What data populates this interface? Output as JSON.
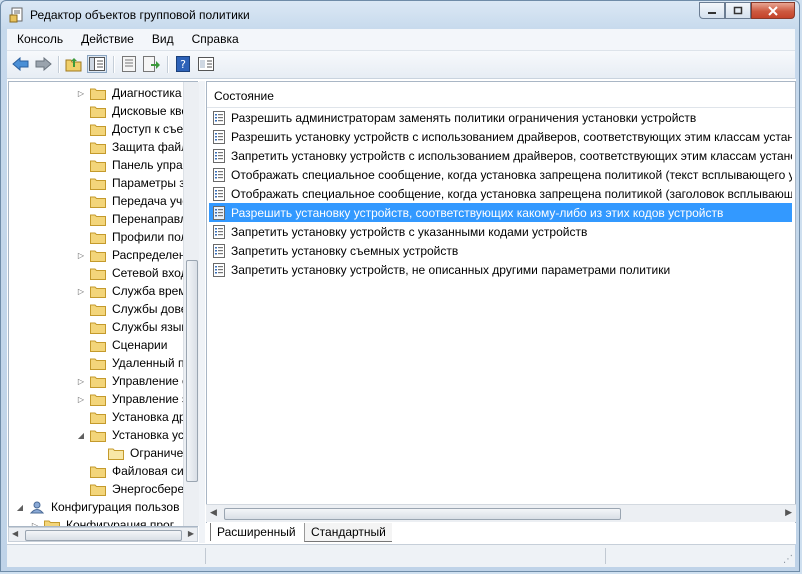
{
  "window": {
    "title": "Редактор объектов групповой политики"
  },
  "menu": [
    "Консоль",
    "Действие",
    "Вид",
    "Справка"
  ],
  "toolbar": {
    "icons": [
      "back-arrow-icon",
      "forward-arrow-icon",
      "up-folder-icon",
      "show-hide-tree-icon",
      "properties-icon",
      "export-list-icon",
      "help-icon",
      "extended-view-icon"
    ]
  },
  "tree": {
    "items": [
      {
        "label": "Диагностика",
        "expandable": true
      },
      {
        "label": "Дисковые кво",
        "expandable": false
      },
      {
        "label": "Доступ к съем",
        "expandable": false
      },
      {
        "label": "Защита файл",
        "expandable": false
      },
      {
        "label": "Панель управ",
        "expandable": false
      },
      {
        "label": "Параметры з",
        "expandable": false
      },
      {
        "label": "Передача уче",
        "expandable": false
      },
      {
        "label": "Перенаправл",
        "expandable": false
      },
      {
        "label": "Профили пол",
        "expandable": false
      },
      {
        "label": "Распределен",
        "expandable": true
      },
      {
        "label": "Сетевой вход",
        "expandable": false
      },
      {
        "label": "Служба врем",
        "expandable": true
      },
      {
        "label": "Службы дове",
        "expandable": false
      },
      {
        "label": "Службы язык",
        "expandable": false
      },
      {
        "label": "Сценарии",
        "expandable": false
      },
      {
        "label": "Удаленный п",
        "expandable": false
      },
      {
        "label": "Управление с",
        "expandable": true
      },
      {
        "label": "Управление э",
        "expandable": true
      },
      {
        "label": "Установка др",
        "expandable": false
      },
      {
        "label": "Установка уст",
        "expandable": true,
        "expanded": true
      },
      {
        "label": "Ограничен",
        "expandable": false,
        "child": true,
        "open": true
      },
      {
        "label": "Файловая сис",
        "expandable": false
      },
      {
        "label": "Энергосбереж",
        "expandable": false
      },
      {
        "label": "Конфигурация пользов",
        "expandable": true,
        "expanded": true,
        "computer": true
      },
      {
        "label": "Конфигурация прог",
        "expandable": true,
        "sub": true
      }
    ]
  },
  "list": {
    "column_header": "Состояние",
    "items": [
      {
        "label": "Разрешить администраторам заменять политики ограничения установки устройств",
        "selected": false
      },
      {
        "label": "Разрешить установку устройств с использованием драйверов, соответствующих этим классам устано",
        "selected": false
      },
      {
        "label": "Запретить установку устройств с использованием драйверов, соответствующих этим классам устано",
        "selected": false
      },
      {
        "label": "Отображать специальное сообщение, когда установка запрещена политикой (текст всплывающего у",
        "selected": false
      },
      {
        "label": "Отображать специальное сообщение, когда установка запрещена политикой (заголовок всплывающ",
        "selected": false
      },
      {
        "label": "Разрешить установку устройств, соответствующих какому-либо из этих кодов устройств",
        "selected": true
      },
      {
        "label": "Запретить установку устройств с указанными кодами устройств",
        "selected": false
      },
      {
        "label": "Запретить установку съемных устройств",
        "selected": false
      },
      {
        "label": "Запретить установку устройств, не описанных другими параметрами политики",
        "selected": false
      }
    ]
  },
  "tabs": [
    "Расширенный",
    "Стандартный"
  ],
  "colors": {
    "selection": "#3399ff",
    "folder": "#f3d57a",
    "title_bg": "#c6d9ec"
  }
}
